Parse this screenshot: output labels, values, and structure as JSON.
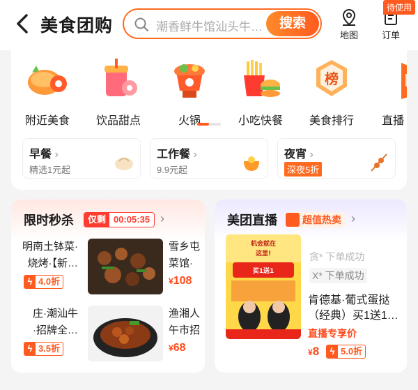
{
  "header": {
    "title": "美食团购",
    "search_placeholder": "潮香鲜牛馆汕头牛…",
    "search_button": "搜索",
    "map_label": "地图",
    "orders_label": "订单",
    "orders_badge": "待使用"
  },
  "categories": [
    {
      "label": "附近美食",
      "icon": "roast-chicken-icon"
    },
    {
      "label": "饮品甜点",
      "icon": "drink-dessert-icon"
    },
    {
      "label": "火锅",
      "icon": "hotpot-icon"
    },
    {
      "label": "小吃快餐",
      "icon": "fries-burger-icon"
    },
    {
      "label": "美食排行",
      "icon": "ranking-medal-icon",
      "glyph": "榜"
    },
    {
      "label": "直播",
      "icon": "live-icon"
    }
  ],
  "carousel": {
    "page": 1,
    "pages": 2
  },
  "meals": [
    {
      "title": "早餐",
      "subtitle": "精选1元起",
      "icon": "bun-icon"
    },
    {
      "title": "工作餐",
      "subtitle": "9.9元起",
      "icon": "orange-bowl-icon"
    },
    {
      "title": "夜宵",
      "subtitle": "深夜5折",
      "icon": "skewer-icon"
    }
  ],
  "flash_sale": {
    "title": "限时秒杀",
    "only_label": "仅剩",
    "countdown": "00:05:35",
    "items": [
      {
        "lines": [
          "明南土钵菜·",
          "烧烤·【新…"
        ],
        "discount": "4.0折",
        "shop_lines": [
          "雪乡屯",
          "菜馆·"
        ],
        "price": "108"
      },
      {
        "lines": [
          "庄·潮汕牛",
          "·招牌全…"
        ],
        "discount": "3.5折",
        "shop_lines": [
          "渔湘人",
          "午市招"
        ],
        "price": "68"
      }
    ]
  },
  "live": {
    "title": "美团直播",
    "hot_label": "超值热卖",
    "feed": [
      "贪* 下单成功",
      "X* 下单成功"
    ],
    "product": "肯德基·葡式蛋挞（经典）买1送1…",
    "price_tag": "直播专享价",
    "price": "8",
    "discount": "5.0折",
    "poster_text": [
      "机会就在",
      "这里!",
      "买1送1"
    ]
  },
  "colors": {
    "accent": "#ff5a1f",
    "price": "#ff4a1a"
  }
}
